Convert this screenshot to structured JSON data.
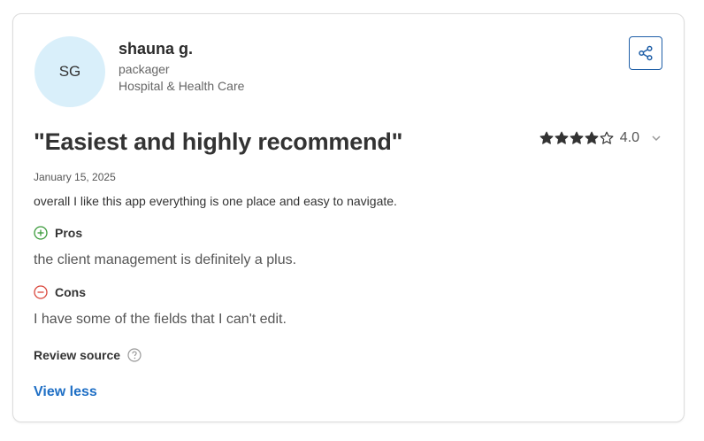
{
  "reviewer": {
    "initials": "SG",
    "name": "shauna g.",
    "role": "packager",
    "industry": "Hospital & Health Care"
  },
  "review": {
    "title": "\"Easiest and highly recommend\"",
    "date": "January 15, 2025",
    "summary": "overall I like this app everything is one place and easy to navigate.",
    "rating": {
      "value": "4.0",
      "stars_filled": 4,
      "stars_total": 5
    },
    "pros_label": "Pros",
    "pros_text": "the client management is definitely a plus.",
    "cons_label": "Cons",
    "cons_text": "I have some of the fields that I can't edit.",
    "source_label": "Review source"
  },
  "actions": {
    "view_less": "View less"
  },
  "colors": {
    "avatar_bg": "#d9effa",
    "accent": "#1f6fc5",
    "pros": "#3a9a3a",
    "cons": "#d9453a",
    "star": "#333333"
  },
  "icons": [
    "share-icon",
    "star-icon",
    "chevron-down-icon",
    "plus-circle-icon",
    "minus-circle-icon",
    "help-circle-icon"
  ]
}
